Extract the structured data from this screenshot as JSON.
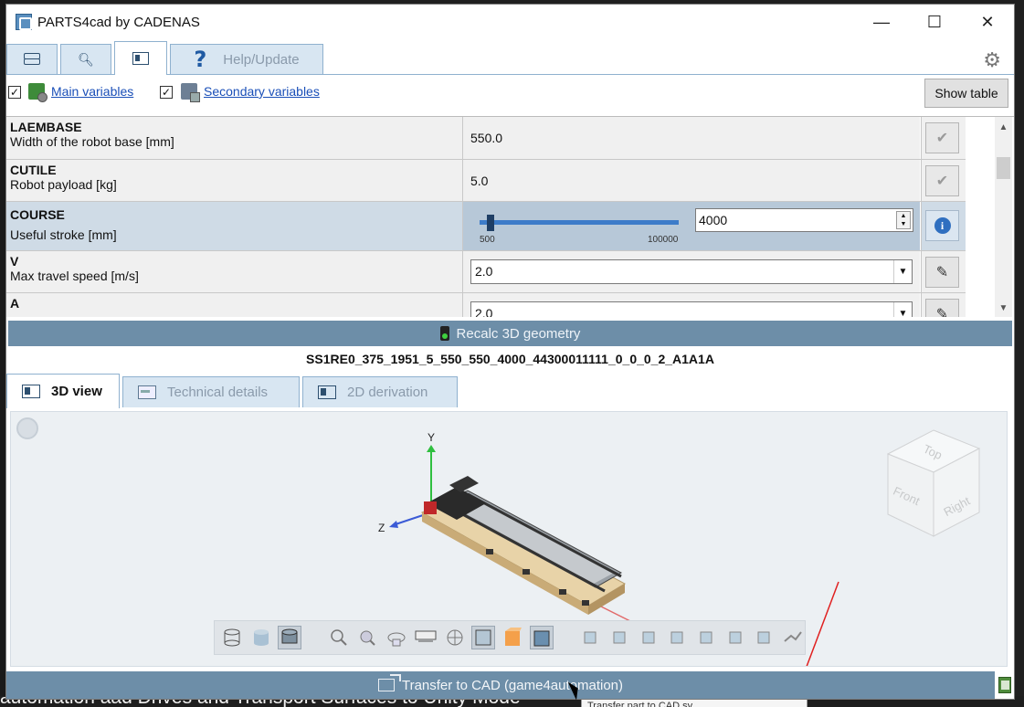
{
  "window": {
    "title": "PARTS4cad by CADENAS"
  },
  "win_controls": {
    "minimize": "—",
    "maximize": "☐",
    "close": "✕"
  },
  "top_tabs": {
    "catalog_icon": "stack-icon",
    "search_icon": "search-icon",
    "param_icon": "parameter-icon",
    "help_label": "Help/Update"
  },
  "variables": {
    "main_checked": true,
    "main_label": "Main variables",
    "secondary_checked": true,
    "secondary_label": "Secondary variables",
    "show_table_label": "Show table"
  },
  "params": [
    {
      "code": "LAEMBASE",
      "desc": "Width of the robot base [mm]",
      "value": "550.0",
      "action": "check-icon"
    },
    {
      "code": "CUTILE",
      "desc": "Robot payload [kg]",
      "value": "5.0",
      "action": "check-icon"
    },
    {
      "code": "COURSE",
      "desc": "Useful stroke [mm]",
      "value": "4000",
      "slider_min": "500",
      "slider_max": "100000",
      "slider_level": 0.035,
      "action": "info-icon"
    },
    {
      "code": "V",
      "desc": "Max travel speed [m/s]",
      "value": "2.0",
      "action": "edit-icon"
    },
    {
      "code": "A",
      "desc": "",
      "value": "2.0",
      "action": "edit-icon"
    }
  ],
  "recalc_label": "Recalc 3D geometry",
  "part_code": "SS1RE0_375_1951_5_550_550_4000_44300011111_0_0_0_2_A1A1A",
  "bottom_tabs": [
    {
      "label": "3D view",
      "active": true
    },
    {
      "label": "Technical details",
      "active": false
    },
    {
      "label": "2D derivation",
      "active": false
    }
  ],
  "viewcube": {
    "top": "Top",
    "front": "Front",
    "right": "Right"
  },
  "axes": {
    "x": "X",
    "y": "Y",
    "z": "Z"
  },
  "transfer_label": "Transfer to CAD (game4automation)",
  "background": {
    "bottom_text": "automation aad Drives and Transport Surfaces to Unity Mode",
    "tooltip_text": "Transfer part to CAD sy"
  },
  "colors": {
    "accent_bar": "#6d8ea8",
    "tab_inactive": "#d8e6f2",
    "link": "#1a4fb8",
    "annotation_arrow": "#e02020"
  }
}
